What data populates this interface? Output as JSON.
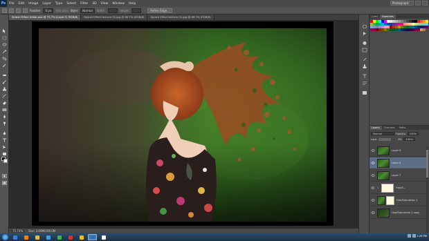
{
  "menubar": {
    "logo": "Ps",
    "items": [
      "File",
      "Edit",
      "Image",
      "Layer",
      "Type",
      "Select",
      "Filter",
      "3D",
      "View",
      "Window",
      "Help"
    ],
    "workspace": "Photography"
  },
  "options": {
    "feather_label": "Feather:",
    "feather_value": "0 px",
    "anti_alias": "Anti-alias",
    "style_label": "Style:",
    "style_value": "Normal",
    "width_label": "Width:",
    "height_label": "Height:",
    "refine_edge": "Refine Edge..."
  },
  "tabs": [
    {
      "label": "Splash Effect Initial.psd @ 75.7% (Layer 8, RGB/8)",
      "active": true
    },
    {
      "label": "Splash Effect texture 02.jpg @ 66.7% (RGB/8)",
      "active": false
    },
    {
      "label": "Splash Effect texture 01.jpg @ 66.7% (RGB/8)",
      "active": false
    }
  ],
  "status": {
    "zoom": "75.74%",
    "doc": "Doc: 3.00M/109.0M"
  },
  "right_panel": {
    "top_tabs": [
      "Color",
      "Swatches"
    ],
    "layers_tabs": [
      "Layers",
      "Channels",
      "Paths"
    ],
    "blend_mode": "Normal",
    "opacity_label": "Opacity:",
    "opacity_value": "100%",
    "lock_label": "Lock:",
    "fill_label": "Fill:",
    "fill_value": "100%",
    "swatch_colors": [
      "#ff0000",
      "#ffff00",
      "#00ff00",
      "#00ffff",
      "#0000ff",
      "#ff00ff",
      "#ffffff",
      "#e6e6e6",
      "#cccccc",
      "#b3b3b3",
      "#999999",
      "#808080",
      "#666666",
      "#4d4d4d",
      "#333333",
      "#1a1a1a",
      "#000000",
      "#ed1c24",
      "#f26522",
      "#f7941d",
      "#fff200",
      "#8dc63f",
      "#39b54a",
      "#00a651",
      "#00a99d",
      "#00aeef",
      "#0072bc",
      "#0054a6",
      "#2e3192",
      "#662d91",
      "#92278f",
      "#ec008c",
      "#ed145b",
      "#f69679",
      "#f9ad81",
      "#fdc689",
      "#fff799",
      "#c4df9b",
      "#a3d39c",
      "#82ca9c",
      "#7accc8",
      "#6dcff6",
      "#7da7d9",
      "#8393ca",
      "#8781bd",
      "#a186be",
      "#bd8cbf",
      "#f49ac1",
      "#f5989d",
      "#9e0b0f",
      "#a0410d",
      "#a36209",
      "#aba000",
      "#598527",
      "#1a7b30",
      "#007236",
      "#00746b",
      "#0076a3",
      "#004b80",
      "#003471",
      "#1b1464",
      "#440e62",
      "#630460",
      "#9e005d",
      "#9e0039",
      "#790000",
      "#7b2e00",
      "#7d4900",
      "#827b00",
      "#406618",
      "#005e20",
      "#005826",
      "#005952",
      "#005b7f",
      "#003663",
      "#002157",
      "#0d004c",
      "#32004b",
      "#4b0049",
      "#7b0046",
      "#7a0026",
      "#c69c6d",
      "#a67c52"
    ],
    "layers": [
      {
        "name": "Layer 6",
        "thumb": "green",
        "selected": false
      },
      {
        "name": "Layer 8",
        "thumb": "green",
        "selected": true
      },
      {
        "name": "Layer 7",
        "thumb": "green",
        "selected": false
      },
      {
        "name": "Hue/S...",
        "thumb": "mask",
        "selected": false
      },
      {
        "name": "Hue/Saturation 1",
        "thumb": "mask",
        "selected": false
      },
      {
        "name": "Hue/Saturation 2 copy",
        "thumb": "darkgreen",
        "selected": false
      }
    ]
  },
  "taskbar": {
    "apps": [
      "#3b7dd8",
      "#ff7a00",
      "#e8b93c",
      "#3aa0e0",
      "#45b14b",
      "#d93030",
      "#f2c200",
      "#2f6fb5",
      "#ffffff"
    ],
    "time": "1:26 PM"
  }
}
